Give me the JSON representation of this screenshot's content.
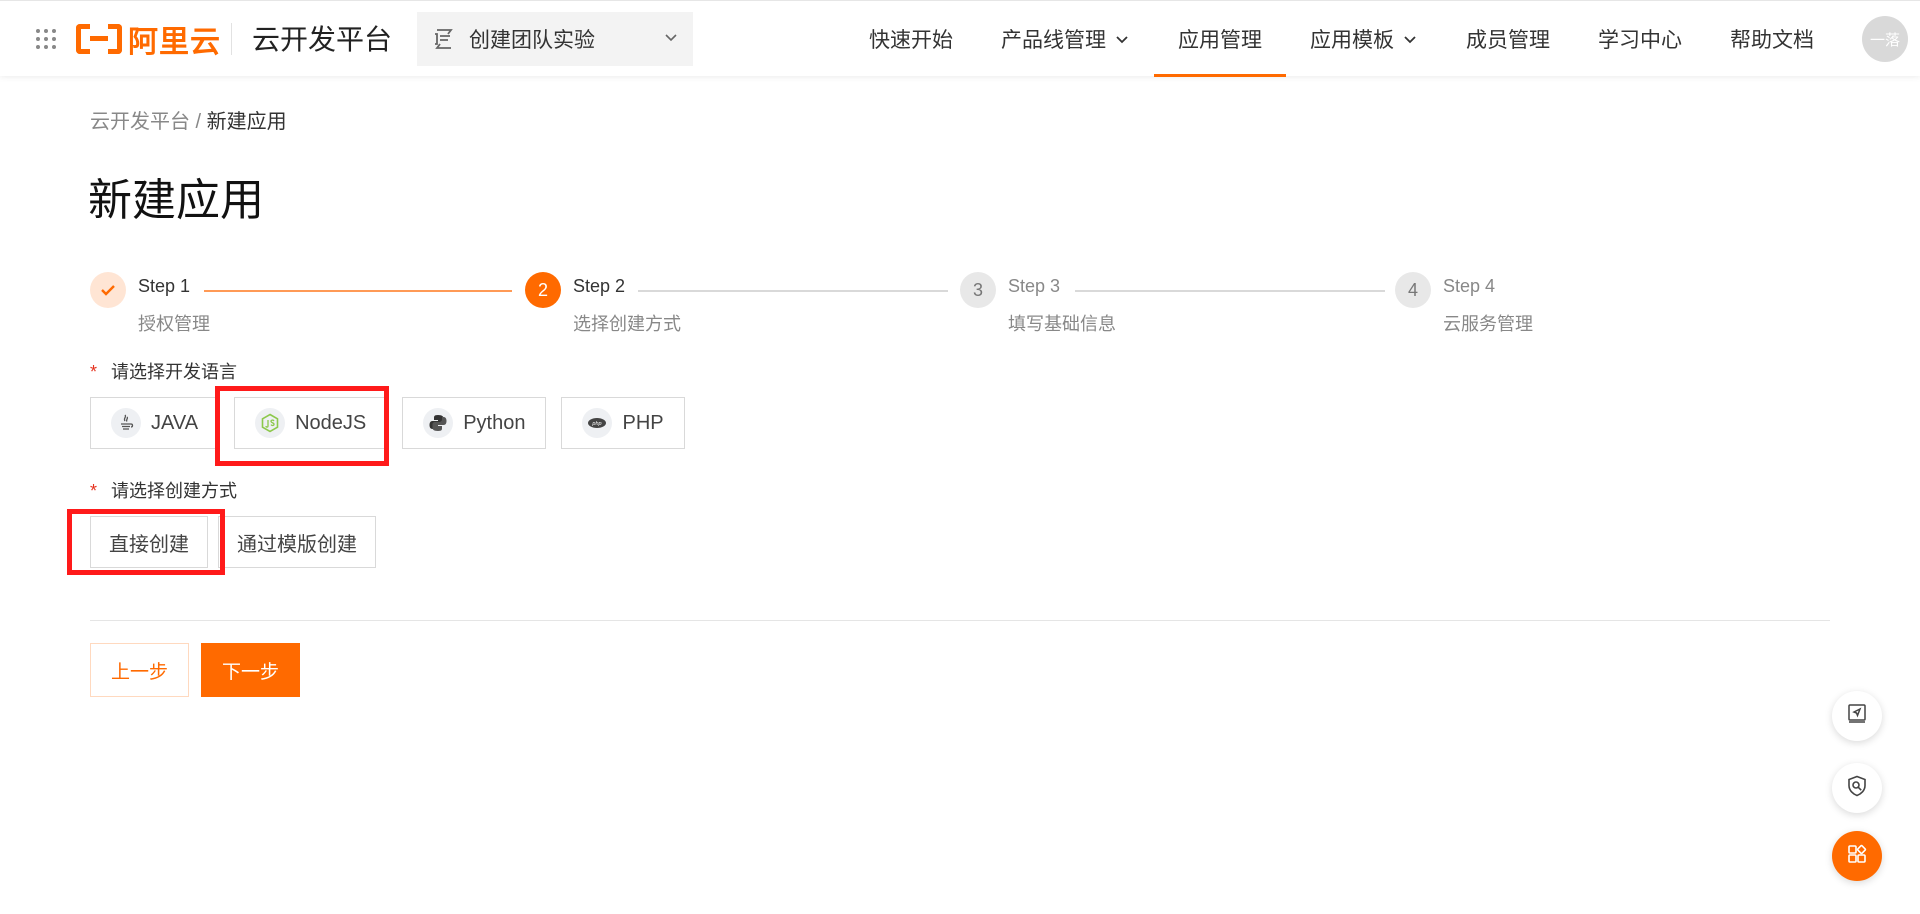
{
  "header": {
    "logo_text": "阿里云",
    "platform_title": "云开发平台",
    "team_select": {
      "value": "创建团队实验"
    },
    "nav": [
      {
        "label": "快速开始",
        "has_dropdown": false,
        "active": false
      },
      {
        "label": "产品线管理",
        "has_dropdown": true,
        "active": false
      },
      {
        "label": "应用管理",
        "has_dropdown": false,
        "active": true
      },
      {
        "label": "应用模板",
        "has_dropdown": true,
        "active": false
      },
      {
        "label": "成员管理",
        "has_dropdown": false,
        "active": false
      },
      {
        "label": "学习中心",
        "has_dropdown": false,
        "active": false
      },
      {
        "label": "帮助文档",
        "has_dropdown": false,
        "active": false
      }
    ],
    "avatar_text": "一落"
  },
  "breadcrumb": {
    "root": "云开发平台",
    "separator": " / ",
    "current": "新建应用"
  },
  "page_title": "新建应用",
  "steps": [
    {
      "title": "Step 1",
      "desc": "授权管理",
      "state": "done",
      "number": "1"
    },
    {
      "title": "Step 2",
      "desc": "选择创建方式",
      "state": "current",
      "number": "2"
    },
    {
      "title": "Step 3",
      "desc": "填写基础信息",
      "state": "todo",
      "number": "3"
    },
    {
      "title": "Step 4",
      "desc": "云服务管理",
      "state": "todo",
      "number": "4"
    }
  ],
  "form": {
    "required_mark": "*",
    "language_label": "请选择开发语言",
    "languages": [
      {
        "label": "JAVA",
        "icon": "java-icon"
      },
      {
        "label": "NodeJS",
        "icon": "nodejs-icon"
      },
      {
        "label": "Python",
        "icon": "python-icon"
      },
      {
        "label": "PHP",
        "icon": "php-icon"
      }
    ],
    "method_label": "请选择创建方式",
    "methods": [
      {
        "label": "直接创建"
      },
      {
        "label": "通过模版创建"
      }
    ]
  },
  "actions": {
    "prev_label": "上一步",
    "next_label": "下一步"
  },
  "colors": {
    "accent": "#ff6a00",
    "highlight": "#ff1a1a",
    "required": "#e5321f"
  }
}
